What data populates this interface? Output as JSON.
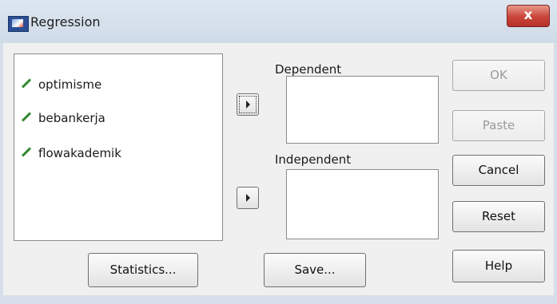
{
  "window": {
    "title": "Regression",
    "close_glyph": "x",
    "icon": "spss-dialog-icon"
  },
  "variables": [
    {
      "name": "optimisme",
      "icon": "scale-variable-icon"
    },
    {
      "name": "bebankerja",
      "icon": "scale-variable-icon"
    },
    {
      "name": "flowakademik",
      "icon": "scale-variable-icon"
    }
  ],
  "dependent": {
    "label": "Dependent"
  },
  "independent": {
    "label": "Independent"
  },
  "buttons": {
    "ok": "OK",
    "paste": "Paste",
    "cancel": "Cancel",
    "reset": "Reset",
    "help": "Help",
    "statistics": "Statistics...",
    "save": "Save..."
  }
}
